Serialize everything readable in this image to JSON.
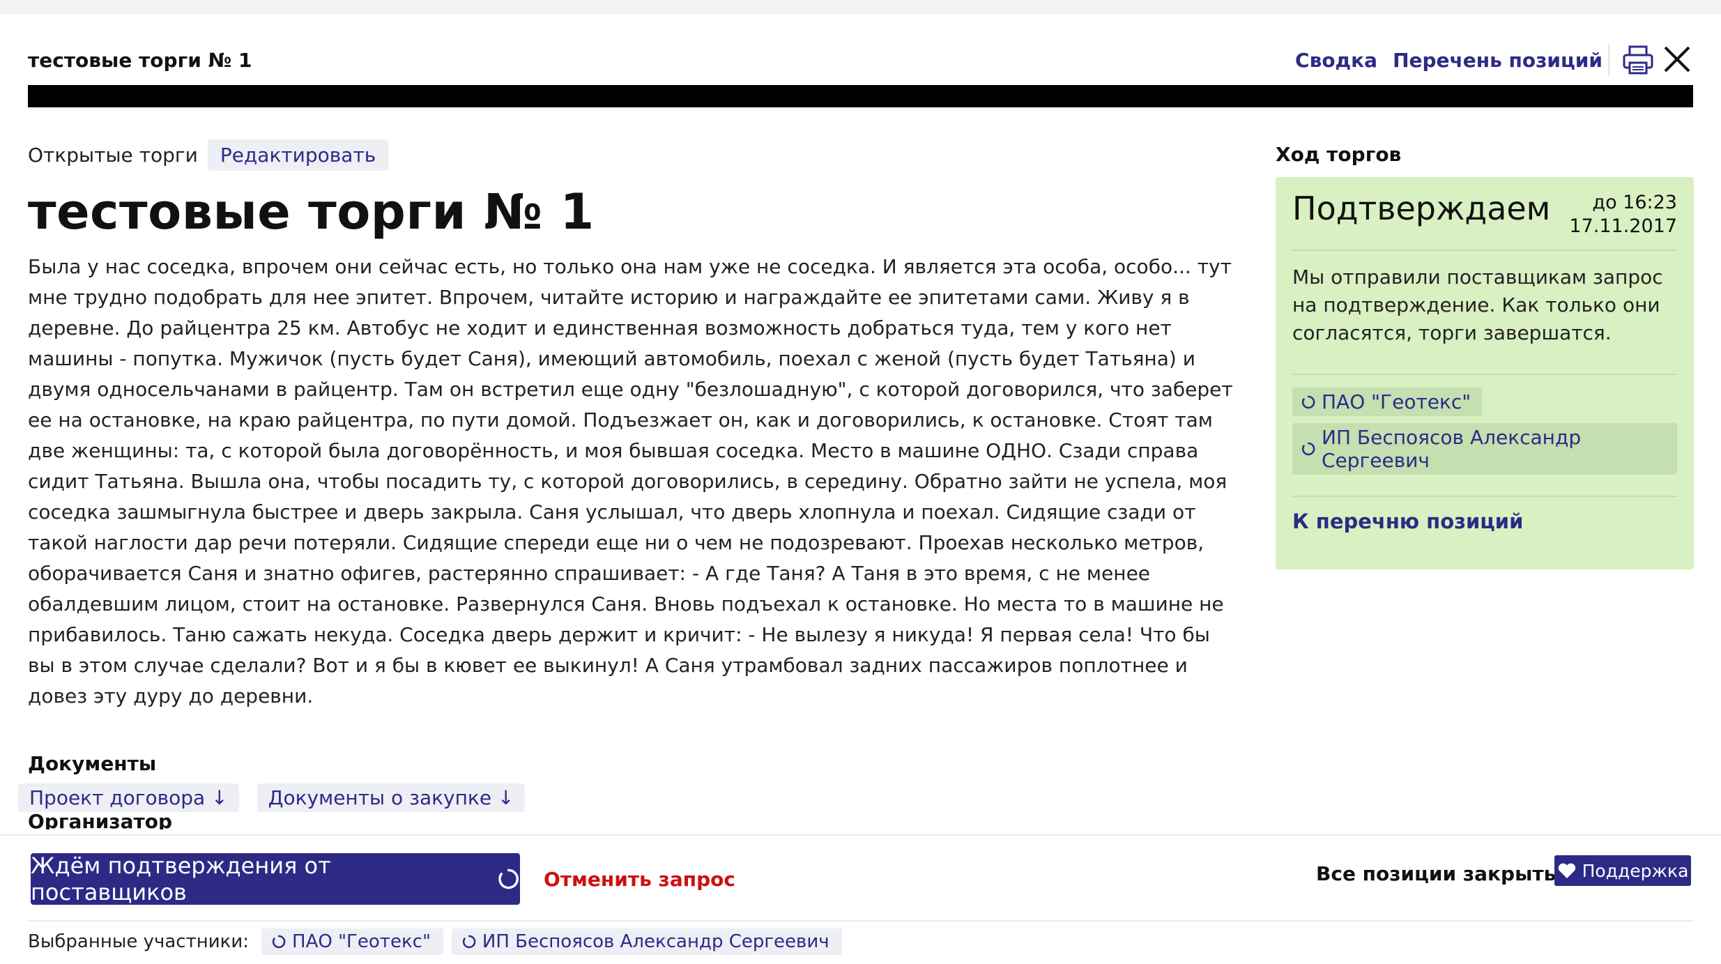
{
  "header": {
    "title": "тестовые торги № 1",
    "links": [
      "Сводка",
      "Перечень позиций"
    ]
  },
  "progress": {
    "value": 1.0
  },
  "tender": {
    "type": "Открытые торги",
    "edit_label": "Редактировать",
    "title": "тестовые торги № 1",
    "description": "Была у нас соседка, впрочем они сейчас есть, но только она нам уже не соседка. И является эта особа, особо... тут мне трудно подобрать для нее эпитет. Впрочем, читайте историю и награждайте ее эпитетами сами. Живу я в деревне. До райцентра 25 км. Автобус не ходит и единственная возможность добраться туда, тем у кого нет машины - попутка. Мужичок (пусть будет Саня), имеющий автомобиль, поехал с женой (пусть будет Татьяна) и двумя односельчанами в райцентр. Там он встретил еще одну \"безлошадную\", с которой договорился, что заберет ее на остановке, на краю райцентра, по пути домой. Подъезжает он, как и договорились, к остановке. Стоят там две женщины: та, с которой была договорённость, и моя бывшая соседка. Место в машине ОДНО. Сзади справа сидит Татьяна. Вышла она, чтобы посадить ту, с которой договорились, в середину. Обратно зайти не успела, моя соседка зашмыгнула быстрее и дверь закрыла. Саня услышал, что дверь хлопнула и поехал. Сидящие сзади от такой наглости дар речи потеряли. Сидящие спереди еще ни о чем не подозревают. Проехав несколько метров, оборачивается Саня и знатно офигев, растерянно спрашивает: - А где Таня? А Таня в это время, с не менее обалдевшим лицом, стоит на остановке. Развернулся Саня. Вновь подъехал к остановке. Но места то в машине не прибавилось. Таню сажать некуда. Соседка дверь держит и кричит: - Не вылезу я никуда! Я первая села! Что бы вы в этом случае сделали? Вот и я бы в кювет ее выкинул! А Саня утрамбовал задних пассажиров поплотнее и довез эту дуру до деревни."
  },
  "documents": {
    "heading": "Документы",
    "items": [
      "Проект договора ↓",
      "Документы о закупке ↓"
    ]
  },
  "organizer": {
    "heading": "Организатор"
  },
  "sidebar": {
    "heading": "Ход торгов",
    "status": "Подтверждаем",
    "deadline_time": "до 16:23",
    "deadline_date": "17.11.2017",
    "text": "Мы отправили поставщикам запрос на подтверждение. Как только они согласятся, торги завершатся.",
    "suppliers": [
      "ПАО \"Геотекс\"",
      "ИП Беспоясов Александр Сергеевич"
    ],
    "positions_link": "К перечню позиций"
  },
  "footer": {
    "wait_button": "Ждём подтверждения от поставщиков",
    "cancel_link": "Отменить запрос",
    "closed_status": "Все позиции закрыты",
    "support_button": "Поддержка",
    "selected_label": "Выбранные участники:",
    "selected": [
      "ПАО \"Геотекс\"",
      "ИП Беспоясов Александр Сергеевич"
    ]
  },
  "colors": {
    "accent": "#2d2a86",
    "status_card": "#d9f0c2",
    "danger": "#cc1111"
  },
  "icons": [
    "print-icon",
    "close-icon",
    "spinner-icon",
    "heart-icon",
    "download-arrow"
  ]
}
